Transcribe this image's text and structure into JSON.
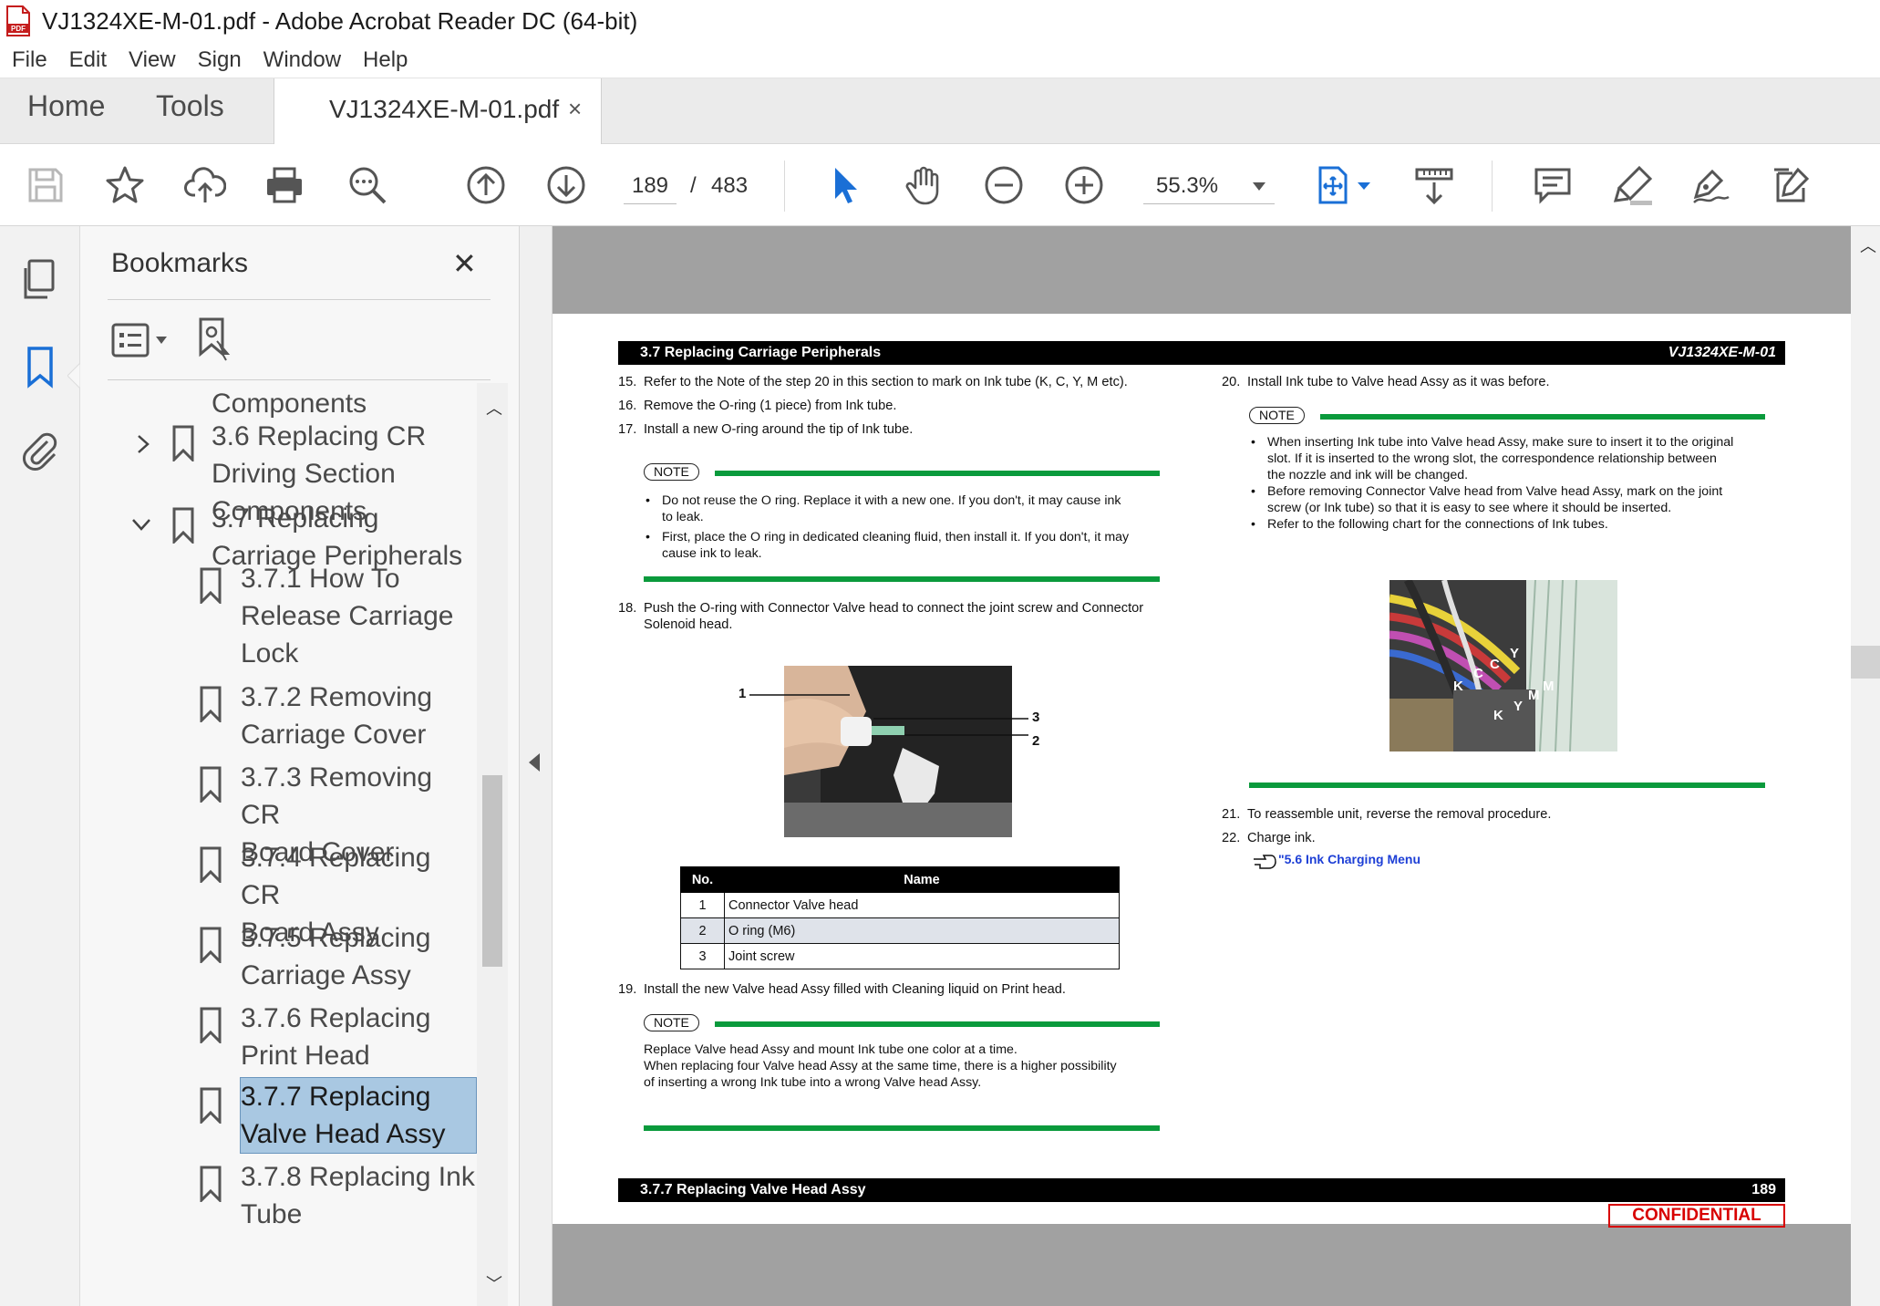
{
  "window": {
    "title": "VJ1324XE-M-01.pdf - Adobe Acrobat Reader DC (64-bit)",
    "app_icon": "acrobat-pdf-icon"
  },
  "menu": [
    "File",
    "Edit",
    "View",
    "Sign",
    "Window",
    "Help"
  ],
  "tabs": {
    "home": "Home",
    "tools": "Tools",
    "document": "VJ1324XE-M-01.pdf",
    "close": "×"
  },
  "toolbar": {
    "current_page": "189",
    "page_separator": "/",
    "total_pages": "483",
    "zoom": "55.3%",
    "icons": [
      "save-icon",
      "star-icon",
      "cloud-upload-icon",
      "print-icon",
      "search-zoom-icon",
      "page-up-icon",
      "page-down-icon",
      "select-cursor-icon",
      "hand-icon",
      "zoom-out-icon",
      "zoom-in-icon",
      "fit-page-icon",
      "scroll-mode-icon",
      "comment-icon",
      "highlight-icon",
      "sign-icon",
      "edit-pdf-icon"
    ]
  },
  "bookmarks": {
    "header": "Bookmarks",
    "close": "✕",
    "items": [
      {
        "lines": [
          "Components"
        ]
      },
      {
        "lines": [
          "3.6 Replacing CR",
          "Driving Section",
          "Components"
        ]
      },
      {
        "lines": [
          "3.7 Replacing",
          "Carriage Peripherals"
        ]
      },
      {
        "lines": [
          "3.7.1 How To",
          "Release Carriage",
          "Lock"
        ]
      },
      {
        "lines": [
          "3.7.2 Removing",
          "Carriage Cover"
        ]
      },
      {
        "lines": [
          "3.7.3 Removing CR",
          "Board Cover"
        ]
      },
      {
        "lines": [
          "3.7.4 Replacing CR",
          "Board Assy"
        ]
      },
      {
        "lines": [
          "3.7.5 Replacing",
          "Carriage Assy"
        ]
      },
      {
        "lines": [
          "3.7.6 Replacing",
          "Print Head"
        ]
      },
      {
        "lines": [
          "3.7.7 Replacing",
          "Valve Head Assy"
        ]
      },
      {
        "lines": [
          "3.7.8 Replacing Ink",
          "Tube"
        ]
      }
    ]
  },
  "page": {
    "header_left": "3.7 Replacing Carriage Peripherals",
    "header_right": "VJ1324XE-M-01",
    "footer_left": "3.7.7 Replacing Valve Head Assy",
    "footer_right": "189",
    "confidential": "CONFIDENTIAL",
    "note_label": "NOTE",
    "left": {
      "step15": {
        "n": "15.",
        "t": "Refer to the Note of the step 20 in this section to mark on Ink tube (K, C, Y, M etc)."
      },
      "step16": {
        "n": "16.",
        "t": "Remove the O-ring (1 piece) from Ink tube."
      },
      "step17": {
        "n": "17.",
        "t": "Install a new O-ring around the tip of Ink tube."
      },
      "note1": [
        [
          "Do not reuse the O ring. Replace it with a new one. If you don't, it may cause ink",
          "to leak."
        ],
        [
          "First, place the O ring in dedicated cleaning fluid, then install it. If you don't, it may",
          "cause ink to leak."
        ]
      ],
      "step18": {
        "n": "18.",
        "t1": "Push the O-ring with Connector Valve head to connect the joint screw and Connector",
        "t2": "Solenoid head."
      },
      "callouts": [
        "1",
        "3",
        "2"
      ],
      "table": {
        "headers": [
          "No.",
          "Name"
        ],
        "rows": [
          [
            "1",
            "Connector Valve head"
          ],
          [
            "2",
            "O ring (M6)"
          ],
          [
            "3",
            "Joint screw"
          ]
        ]
      },
      "step19": {
        "n": "19.",
        "t": "Install the new Valve head Assy filled with Cleaning liquid on Print head."
      },
      "note3": [
        "Replace Valve head Assy and mount Ink tube one color at a time.",
        "When replacing four Valve head Assy at the same time, there is a higher possibility",
        "of inserting a wrong Ink tube into a wrong Valve head Assy."
      ]
    },
    "right": {
      "step20": {
        "n": "20.",
        "t": "Install Ink tube to Valve head Assy as it was before."
      },
      "note2": [
        [
          "When inserting Ink tube into Valve head Assy, make sure to insert it to the original",
          "slot. If it is inserted to the wrong slot, the correspondence relationship between",
          "the nozzle and ink will be changed."
        ],
        [
          "Before removing Connector Valve head from Valve head Assy, mark on the joint",
          "screw (or Ink tube) so that it is easy to see where it should be inserted."
        ],
        [
          "Refer to the following chart for the connections of Ink tubes."
        ]
      ],
      "photo_labels": [
        "Y",
        "C",
        "C",
        "K",
        "M",
        "M",
        "Y",
        "K"
      ],
      "step21": {
        "n": "21.",
        "t": "To reassemble unit, reverse the removal procedure."
      },
      "step22": {
        "n": "22.",
        "t": "Charge ink."
      },
      "link": "\"5.6 Ink Charging Menu"
    }
  }
}
